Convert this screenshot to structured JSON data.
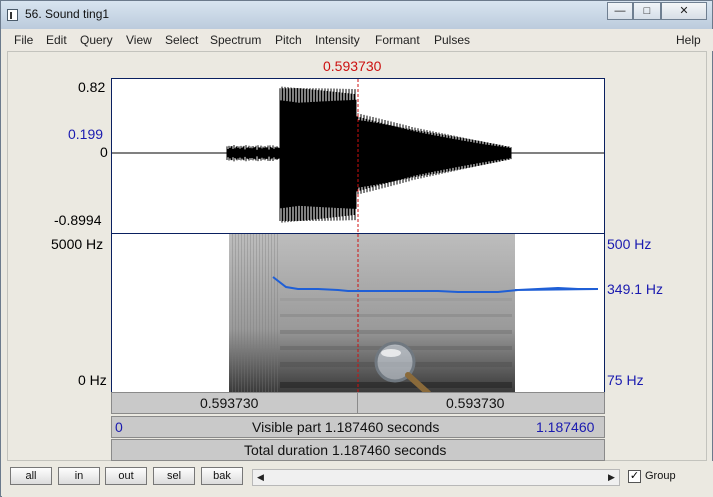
{
  "window": {
    "title": "56. Sound ting1",
    "minimize": "—",
    "maximize": "□",
    "close": "✕"
  },
  "menu": [
    "File",
    "Edit",
    "Query",
    "View",
    "Select",
    "Spectrum",
    "Pitch",
    "Intensity",
    "Formant",
    "Pulses",
    "Help"
  ],
  "cursor": {
    "time": "0.593730"
  },
  "waveform": {
    "ymax": "0.82",
    "ycursor": "0.199",
    "yzero": "0",
    "ymin": "-0.8994"
  },
  "spectrogram": {
    "freq_max": "5000 Hz",
    "freq_min": "0 Hz",
    "pitch_max": "500 Hz",
    "pitch_value": "349.1 Hz",
    "pitch_min": "75 Hz"
  },
  "time_bar": {
    "left": "0.593730",
    "right": "0.593730"
  },
  "visible_bar": {
    "start": "0",
    "label": "Visible part 1.187460 seconds",
    "end": "1.187460"
  },
  "total_bar": {
    "label": "Total duration 1.187460 seconds"
  },
  "buttons": {
    "all": "all",
    "in": "in",
    "out": "out",
    "sel": "sel",
    "bak": "bak"
  },
  "scroll": {
    "left": "◀",
    "right": "▶"
  },
  "group": {
    "label": "Group",
    "checked": "✓"
  },
  "colors": {
    "cursor": "#cc1111",
    "pitch": "#1f5fd6",
    "axis_blue": "#1a1ab0"
  }
}
